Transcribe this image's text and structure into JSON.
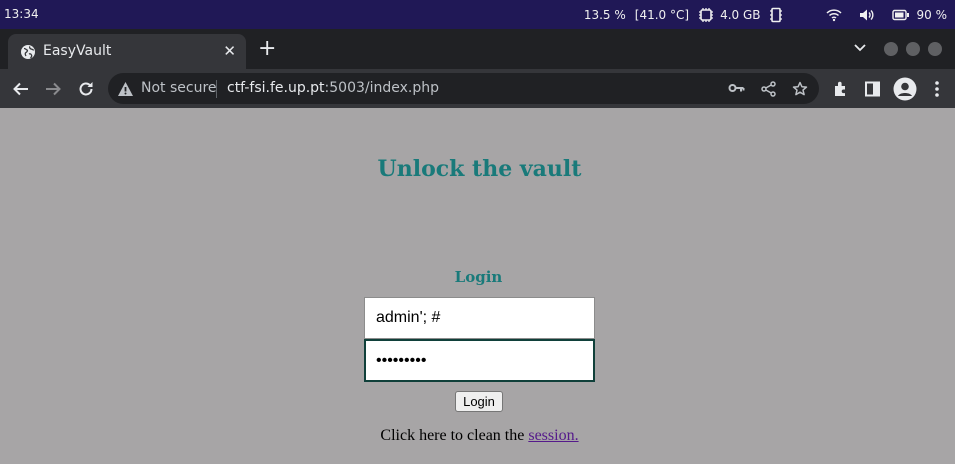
{
  "system_bar": {
    "clock": "13:34",
    "cpu": "13.5 %",
    "temperature": "[41.0 °C]",
    "memory": "4.0 GB",
    "battery": "90 %",
    "icons": [
      "cpu-chip-icon",
      "memory-icon",
      "wifi-icon",
      "volume-icon",
      "battery-icon"
    ]
  },
  "browser": {
    "tab_title": "EasyVault",
    "tab_close": "✕",
    "new_tab": "+",
    "security_label": "Not secure",
    "url_host": "ctf-fsi.fe.up.pt",
    "url_rest": ":5003/index.php",
    "icons": [
      "globe-icon",
      "back-icon",
      "forward-icon",
      "reload-icon",
      "warning-icon",
      "key-icon",
      "share-icon",
      "star-icon",
      "extensions-icon",
      "side-panel-icon",
      "profile-icon",
      "menu-icon"
    ]
  },
  "page": {
    "heading": "Unlock the vault",
    "login_label": "Login",
    "username_value": "admin'; #",
    "password_value": "admin1234",
    "login_button": "Login",
    "clean_text": "Click here to clean the ",
    "clean_link": "session."
  },
  "colors": {
    "page_background": "#a7a5a6",
    "heading_color": "#197a7a",
    "link_color": "#551a8b",
    "system_bar": "#201856"
  }
}
